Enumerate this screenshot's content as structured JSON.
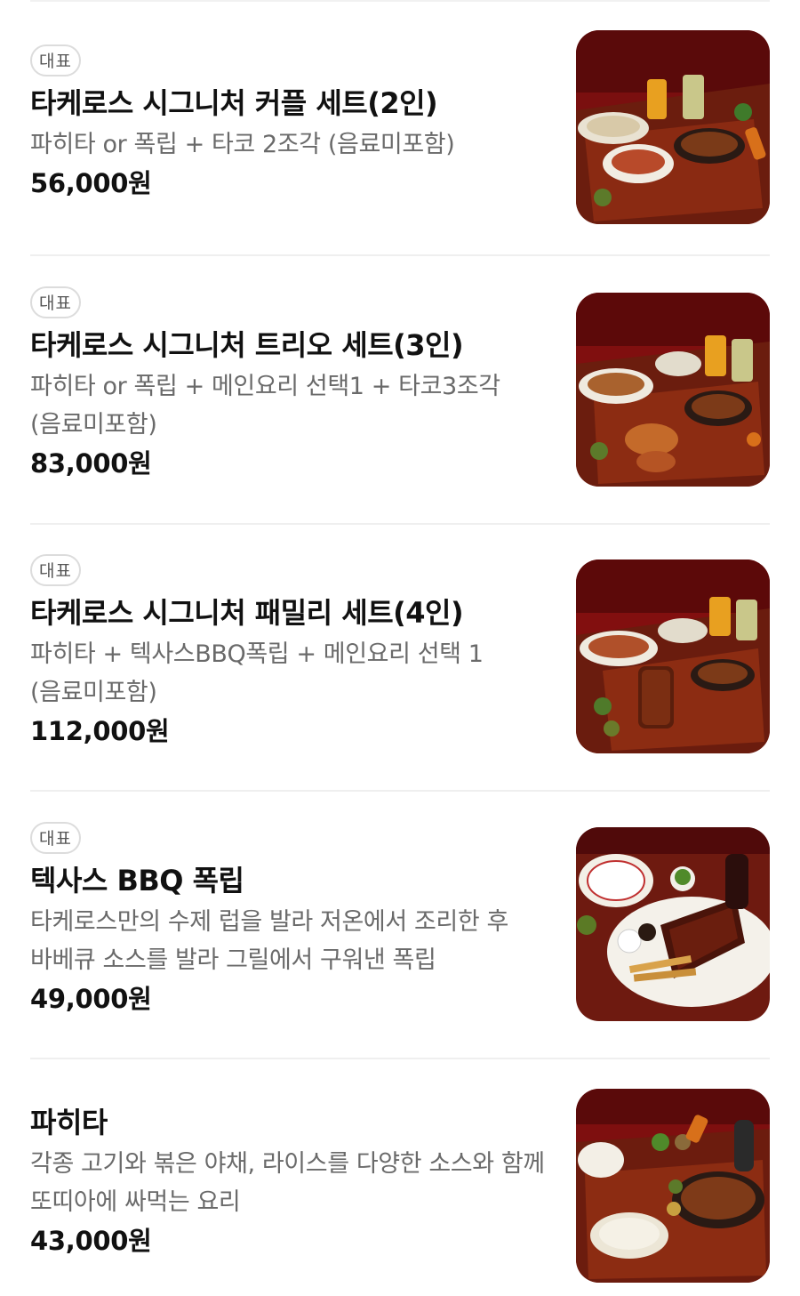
{
  "menu": {
    "items": [
      {
        "badge": "대표",
        "name": "타케로스 시그니처 커플 세트(2인)",
        "description": "파히타 or 폭립 + 타코 2조각 (음료미포함)",
        "price": "56,000원",
        "image": "fajita-taco-couple-set-photo"
      },
      {
        "badge": "대표",
        "name": "타케로스 시그니처 트리오 세트(3인)",
        "description": "파히타 or 폭립 + 메인요리 선택1 + 타코3조각 (음료미포함)",
        "price": "83,000원",
        "image": "trio-set-platter-photo"
      },
      {
        "badge": "대표",
        "name": "타케로스 시그니처 패밀리 세트(4인)",
        "description": "파히타 + 텍사스BBQ폭립 + 메인요리 선택 1 (음료미포함)",
        "price": "112,000원",
        "image": "family-set-platter-photo"
      },
      {
        "badge": "대표",
        "name": "텍사스 BBQ 폭립",
        "description": "타케로스만의 수제 럽을 발라 저온에서 조리한 후 바베큐 소스를 발라 그릴에서 구워낸 폭립",
        "price": "49,000원",
        "image": "bbq-pork-ribs-photo"
      },
      {
        "badge": "",
        "name": "파히타",
        "description": "각종 고기와 볶은 야채, 라이스를 다양한 소스와 함께 또띠아에 싸먹는 요리",
        "price": "43,000원",
        "image": "fajita-skillet-photo"
      }
    ]
  },
  "colors": {
    "badge_border": "#dcdcdc",
    "text_primary": "#111111",
    "text_secondary": "#6a6a6a",
    "photo_red": "#8e1414",
    "photo_table": "#6e1e10"
  }
}
